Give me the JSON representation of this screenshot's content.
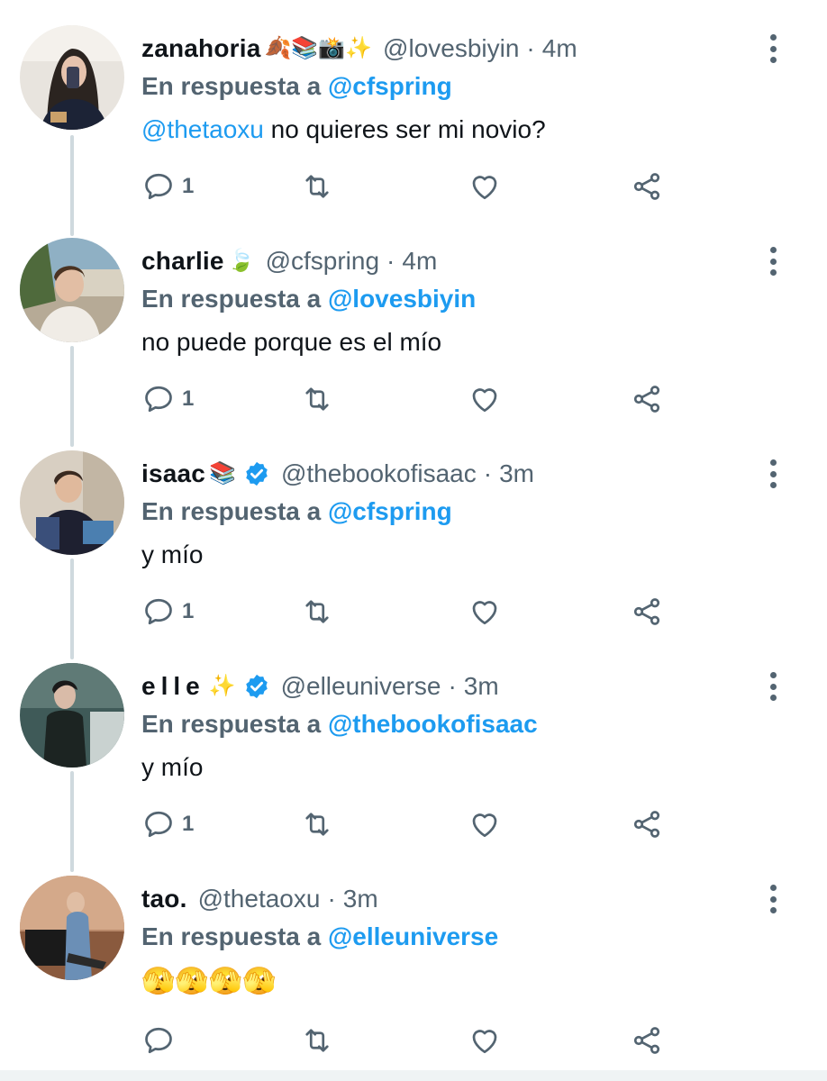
{
  "reply_prefix": "En respuesta a",
  "tweets": [
    {
      "name": "zanahoria",
      "name_emoji": "🍂📚📸✨",
      "verified": false,
      "handle": "@lovesbiyin",
      "dot": "·",
      "time": "4m",
      "reply_to": "@cfspring",
      "body_mention": "@thetaoxu",
      "body_text": " no quieres ser mi novio?",
      "reply_count": "1"
    },
    {
      "name": "charlie",
      "name_emoji": "🍃",
      "verified": false,
      "handle": "@cfspring",
      "dot": "·",
      "time": "4m",
      "reply_to": "@lovesbiyin",
      "body_mention": "",
      "body_text": "no puede porque es el mío",
      "reply_count": "1"
    },
    {
      "name": "isaac",
      "name_emoji": "📚",
      "verified": true,
      "handle": "@thebookofisaac",
      "dot": "·",
      "time": "3m",
      "reply_to": "@cfspring",
      "body_mention": "",
      "body_text": "y mío",
      "reply_count": "1"
    },
    {
      "name": "elle",
      "name_emoji": "✨",
      "verified": true,
      "handle": "@elleuniverse",
      "dot": "·",
      "time": "3m",
      "reply_to": "@thebookofisaac",
      "body_mention": "",
      "body_text": "y mío",
      "reply_count": "1"
    },
    {
      "name": "tao.",
      "name_emoji": "",
      "verified": false,
      "handle": "@thetaoxu",
      "dot": "·",
      "time": "3m",
      "reply_to": "@elleuniverse",
      "body_mention": "",
      "body_text": "🫣🫣🫣🫣",
      "reply_count": ""
    }
  ],
  "icons": {
    "reply": "reply-bubble-icon",
    "retweet": "retweet-icon",
    "like": "heart-icon",
    "share": "share-icon",
    "more": "more-vertical-icon",
    "verified": "verified-badge-icon"
  },
  "colors": {
    "link": "#1d9bf0",
    "secondary": "#536471",
    "verified": "#1d9bf0",
    "thread_line": "#cfd9de"
  }
}
